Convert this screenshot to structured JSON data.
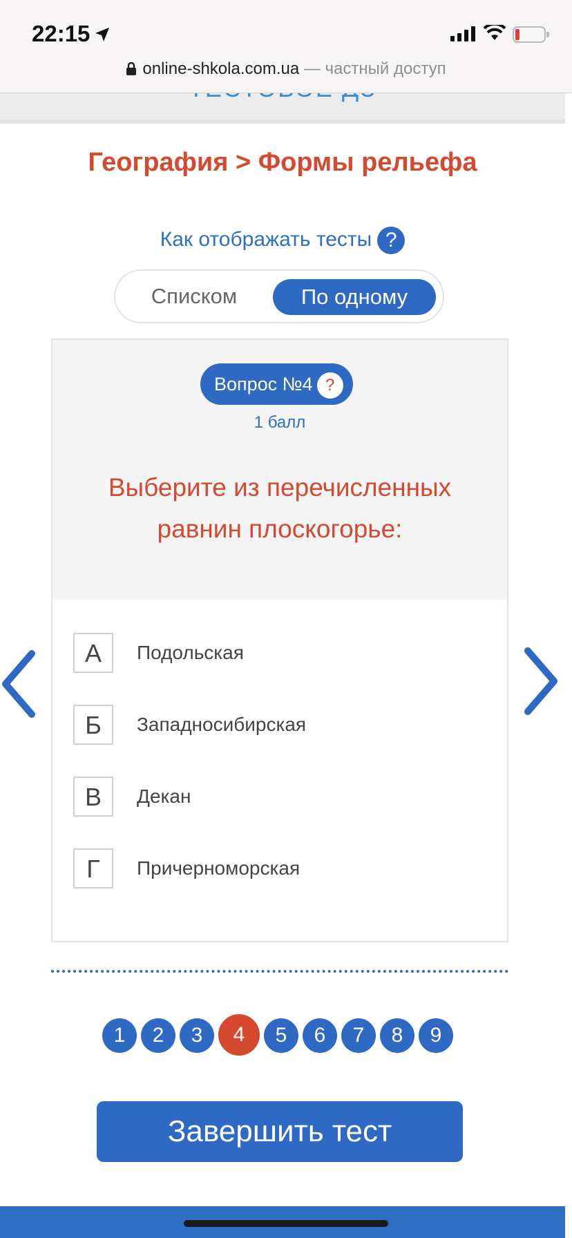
{
  "status": {
    "time": "22:15",
    "url": "online-shkola.com.ua",
    "private": " — частный доступ",
    "icons": [
      "location-arrow-icon",
      "signal-icon",
      "wifi-icon",
      "battery-low-icon",
      "lock-icon"
    ]
  },
  "page": {
    "top_cut_text": "ТЕСТОВОЕ ДЗ",
    "breadcrumb": "География > Формы рельефа",
    "display_label": "Как отображать тесты",
    "help_symbol": "?",
    "toggle": {
      "list": "Списком",
      "one": "По одному",
      "selected": "По одному"
    }
  },
  "question": {
    "number_label": "Вопрос №4",
    "help_symbol": "?",
    "points": "1 балл",
    "text": "Выберите из перечисленных равнин плоскогорье:",
    "answers": [
      {
        "letter": "А",
        "text": "Подольская"
      },
      {
        "letter": "Б",
        "text": "Западносибирская"
      },
      {
        "letter": "В",
        "text": "Декан"
      },
      {
        "letter": "Г",
        "text": "Причерноморская"
      }
    ]
  },
  "pager": {
    "pages": [
      "1",
      "2",
      "3",
      "4",
      "5",
      "6",
      "7",
      "8",
      "9"
    ],
    "current": "4"
  },
  "finish_label": "Завершить тест",
  "colors": {
    "accent": "#2e69c3",
    "title": "#d4492f"
  }
}
